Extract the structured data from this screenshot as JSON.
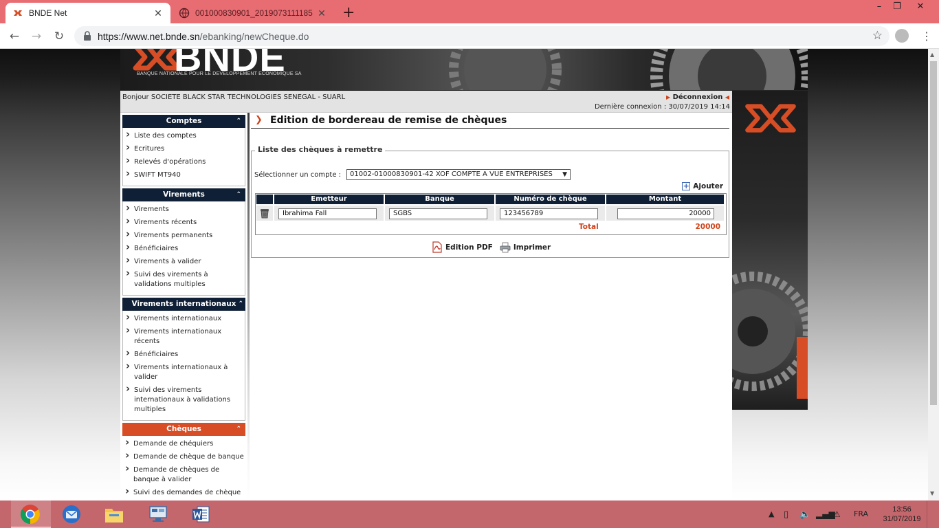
{
  "browser": {
    "tabs": [
      {
        "title": "BNDE Net",
        "active": true
      },
      {
        "title": "001000830901_2019073111185",
        "active": false
      }
    ],
    "url_host": "https://www.net.bnde.sn",
    "url_path": "/ebanking/newCheque.do",
    "new_tab_glyph": "+",
    "colors": {
      "tabbar": "#e76d73",
      "accent": "#d74d25",
      "navy": "#0f1f35"
    }
  },
  "header": {
    "logo_text": "BNDE",
    "logo_subtitle": "BANQUE NATIONALE POUR LE DEVELOPPEMENT ECONOMIQUE SA"
  },
  "welcome": {
    "greeting": "Bonjour SOCIETE BLACK STAR TECHNOLOGIES SENEGAL - SUARL",
    "logout": "Déconnexion",
    "last_login": "Dernière connexion : 30/07/2019 14:14"
  },
  "sidebar": {
    "sections": [
      {
        "title": "Comptes",
        "items": [
          "Liste des comptes",
          "Ecritures",
          "Relevés d'opérations",
          "SWIFT MT940"
        ]
      },
      {
        "title": "Virements",
        "items": [
          "Virements",
          "Virements récents",
          "Virements permanents",
          "Bénéficiaires",
          "Virements à valider",
          "Suivi des virements à validations multiples"
        ]
      },
      {
        "title": "Virements internationaux",
        "items": [
          "Virements internationaux",
          "Virements internationaux récents",
          "Bénéficiaires",
          "Virements internationaux à valider",
          "Suivi des virements internationaux à validations multiples"
        ]
      },
      {
        "title": "Chèques",
        "items": [
          "Demande de chéquiers",
          "Demande de chèque de banque",
          "Demande de chèques de banque à valider",
          "Suivi des demandes de chèque"
        ]
      }
    ]
  },
  "main": {
    "title": "Edition de bordereau de remise de chèques",
    "legend": "Liste des chèques à remettre",
    "select_label": "Sélectionner un compte :",
    "selected_account": "01002-01000830901-42 XOF COMPTE A VUE ENTREPRISES",
    "add_label": "Ajouter",
    "columns": [
      "Emetteur",
      "Banque",
      "Numéro de chèque",
      "Montant"
    ],
    "rows": [
      {
        "emetteur": "Ibrahima Fall",
        "banque": "SGBS",
        "numero": "123456789",
        "montant": "20000"
      }
    ],
    "total_label": "Total",
    "total_value": "20000",
    "pdf_label": "Edition PDF",
    "print_label": "Imprimer"
  },
  "taskbar": {
    "apps": [
      "chrome-icon",
      "thunderbird-icon",
      "file-explorer-icon",
      "remote-desktop-icon",
      "word-icon"
    ],
    "language": "FRA",
    "time": "13:56",
    "date": "31/07/2019"
  }
}
